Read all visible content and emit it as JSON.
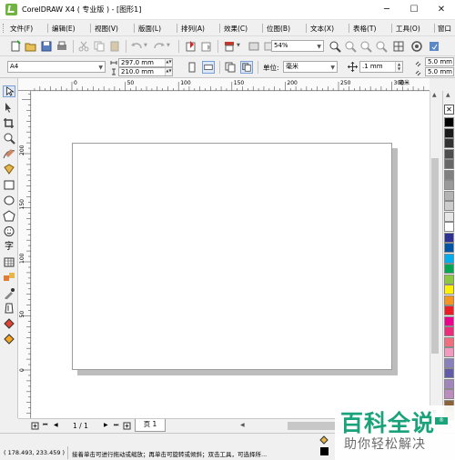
{
  "window": {
    "title": "CorelDRAW X4 ( 专业版 ) - [图形1]",
    "minimize": "─",
    "maximize": "☐",
    "close": "✕"
  },
  "menu": [
    {
      "label": "文件(F)"
    },
    {
      "label": "编辑(E)"
    },
    {
      "label": "视图(V)"
    },
    {
      "label": "版面(L)"
    },
    {
      "label": "排列(A)"
    },
    {
      "label": "效果(C)"
    },
    {
      "label": "位图(B)"
    },
    {
      "label": "文本(X)"
    },
    {
      "label": "表格(T)"
    },
    {
      "label": "工具(O)"
    },
    {
      "label": "窗口"
    }
  ],
  "toolbar": {
    "zoom_value": "54%"
  },
  "property_bar": {
    "page_size": "A4",
    "width": "297.0 mm",
    "height": "210.0 mm",
    "units_label": "单位:",
    "units_value": "毫米",
    "nudge": ".1 mm",
    "dup_x": "5.0 mm",
    "dup_y": "5.0 mm"
  },
  "ruler": {
    "h_ticks": [
      {
        "label": "0",
        "pos": 0
      },
      {
        "label": "50",
        "pos": 50
      },
      {
        "label": "100",
        "pos": 100
      },
      {
        "label": "150",
        "pos": 150
      },
      {
        "label": "200",
        "pos": 200
      },
      {
        "label": "250",
        "pos": 250
      },
      {
        "label": "300",
        "pos": 300
      }
    ],
    "v_ticks": [
      {
        "label": "200",
        "pos": 200
      },
      {
        "label": "150",
        "pos": 150
      },
      {
        "label": "100",
        "pos": 100
      },
      {
        "label": "50",
        "pos": 50
      },
      {
        "label": "0",
        "pos": 0
      }
    ],
    "unit": "毫米"
  },
  "page_nav": {
    "counter": "1 / 1",
    "tab": "页 1"
  },
  "status": {
    "coords": "( 178.493, 233.459 )",
    "hint": "接着单击可进行拖动或缩放；再单击可旋转或倾斜；双击工具，可选择所..."
  },
  "palette": {
    "colors": [
      "#000000",
      "#1a1a1a",
      "#333333",
      "#4d4d4d",
      "#666666",
      "#808080",
      "#999999",
      "#b3b3b3",
      "#cccccc",
      "#e6e6e6",
      "#ffffff",
      "#2e3192",
      "#0054a6",
      "#00aeef",
      "#00a651",
      "#8dc63f",
      "#fff200",
      "#f7941d",
      "#ed1c24",
      "#ec008c",
      "#ee2a7b",
      "#f26d7d",
      "#f49ac1",
      "#8781bd",
      "#605ca8",
      "#a186be",
      "#bd8cbf",
      "#8c6239",
      "#c69c6d"
    ]
  },
  "watermark": {
    "title": "百科全说",
    "subtitle": "助你轻松解决",
    "badge": "®"
  }
}
